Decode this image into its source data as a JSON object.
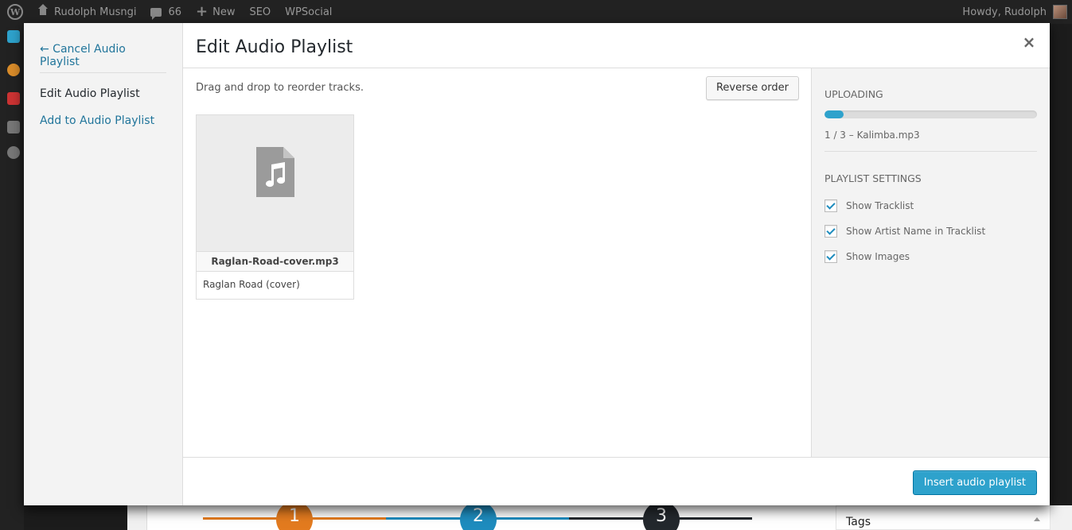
{
  "adminbar": {
    "site_name": "Rudolph Musngi",
    "comments_count": "66",
    "new_label": "New",
    "seo_label": "SEO",
    "wpsocial_label": "WPSocial",
    "howdy": "Howdy, Rudolph"
  },
  "modal": {
    "title": "Edit Audio Playlist",
    "close_symbol": "×",
    "menu": {
      "cancel": "← Cancel Audio Playlist",
      "active": "Edit Audio Playlist",
      "add": "Add to Audio Playlist"
    },
    "instructions": "Drag and drop to reorder tracks.",
    "reverse_button": "Reverse order",
    "attachments": [
      {
        "filename": "Raglan-Road-cover.mp3",
        "caption": "Raglan Road (cover)",
        "icon": "audio-file-icon"
      }
    ],
    "sidebar": {
      "uploading_heading": "Uploading",
      "progress_percent": 9,
      "upload_status": "1 / 3  –  Kalimba.mp3",
      "settings_heading": "Playlist Settings",
      "settings": [
        {
          "label": "Show Tracklist",
          "checked": true
        },
        {
          "label": "Show Artist Name in Tracklist",
          "checked": true
        },
        {
          "label": "Show Images",
          "checked": true
        }
      ]
    },
    "insert_button": "Insert audio playlist"
  },
  "background": {
    "steps": [
      "1",
      "2",
      "3"
    ],
    "tags_label": "Tags"
  },
  "colors": {
    "accent": "#2ea2cc",
    "link": "#21759b",
    "step1": "#e37b1f",
    "step2": "#1e8cbe",
    "step3": "#23282d"
  }
}
